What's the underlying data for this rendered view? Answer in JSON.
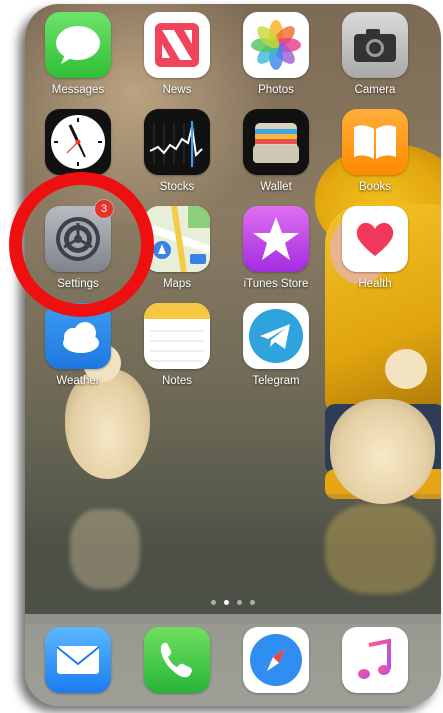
{
  "home_screen": {
    "rows": [
      [
        {
          "label": "Messages",
          "icon": "messages-icon"
        },
        {
          "label": "News",
          "icon": "news-icon"
        },
        {
          "label": "Photos",
          "icon": "photos-icon"
        },
        {
          "label": "Camera",
          "icon": "camera-icon"
        }
      ],
      [
        {
          "label": "",
          "icon": "clock-icon"
        },
        {
          "label": "Stocks",
          "icon": "stocks-icon"
        },
        {
          "label": "Wallet",
          "icon": "wallet-icon"
        },
        {
          "label": "Books",
          "icon": "books-icon"
        }
      ],
      [
        {
          "label": "Settings",
          "icon": "settings-icon",
          "badge": "3"
        },
        {
          "label": "Maps",
          "icon": "maps-icon"
        },
        {
          "label": "iTunes Store",
          "icon": "itunes-store-icon"
        },
        {
          "label": "Health",
          "icon": "health-icon"
        }
      ],
      [
        {
          "label": "Weather",
          "icon": "weather-icon"
        },
        {
          "label": "Notes",
          "icon": "notes-icon"
        },
        {
          "label": "Telegram",
          "icon": "telegram-icon"
        }
      ]
    ],
    "page_dots": {
      "count": 4,
      "active_index": 1
    }
  },
  "dock": {
    "apps": [
      {
        "icon": "mail-icon"
      },
      {
        "icon": "phone-icon"
      },
      {
        "icon": "safari-icon"
      },
      {
        "icon": "music-icon"
      }
    ]
  },
  "annotation": {
    "target": "settings",
    "color": "#ee1010"
  }
}
